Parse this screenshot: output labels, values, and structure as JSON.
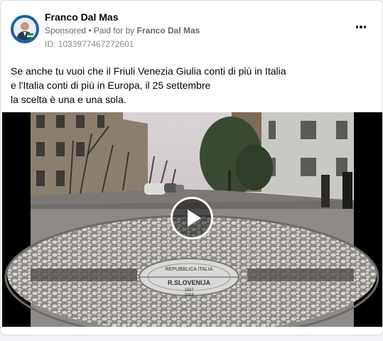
{
  "post": {
    "author_name": "Franco Dal Mas",
    "sponsored_label": "Sponsored",
    "paid_for_prefix": "Paid for by",
    "paid_for_name": "Franco Dal Mas",
    "ad_id": "ID: 1033977467272601",
    "body_lines": [
      "Se anche tu vuoi che il Friuli Venezia Giulia conti di più in Italia",
      "e l'Italia conti di più in Europa, il 25 settembre",
      "la scelta è una e una sola."
    ]
  },
  "media": {
    "type": "video",
    "plaque_lines": [
      "REPUBBLICA ITALIA",
      "R.SLOVENIJA",
      "1947",
      "2004"
    ]
  },
  "icons": {
    "more": "more-horizontal-icon",
    "play": "play-icon"
  },
  "colors": {
    "avatar_ring": "#1b5fa8",
    "secondary_text": "#65676b",
    "card_border": "#dddfe2"
  }
}
